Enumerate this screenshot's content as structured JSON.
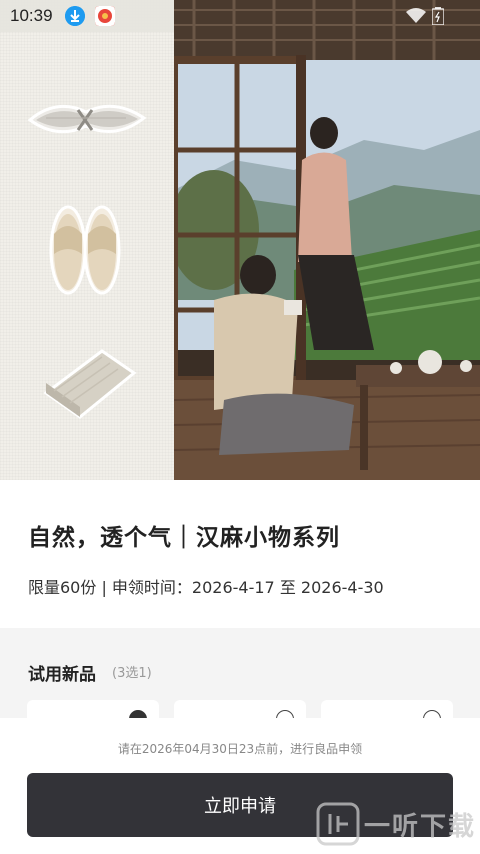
{
  "status_bar": {
    "time": "10:39",
    "icons": [
      "download-icon",
      "app-notification-icon",
      "wifi-icon",
      "battery-icon"
    ]
  },
  "hero": {
    "products": [
      "scarf-icon",
      "slippers-icon",
      "towel-icon"
    ],
    "scene": "photo-two-people-tea-room"
  },
  "product": {
    "title": "自然，透个气｜汉麻小物系列",
    "meta": "限量60份 | 申领时间：2026-4-17 至 2026-4-30"
  },
  "trial": {
    "title": "试用新品",
    "subtitle": "(3选1)",
    "options_selected": [
      true,
      false,
      false
    ]
  },
  "footer": {
    "deadline": "请在2026年04月30日23点前，进行良品申领",
    "apply_label": "立即申请"
  },
  "watermark": {
    "text": "一听下载"
  },
  "colors": {
    "button_bg": "#333338",
    "section_bg": "#f4f4f4",
    "accent_blue": "#1e9bf0"
  }
}
